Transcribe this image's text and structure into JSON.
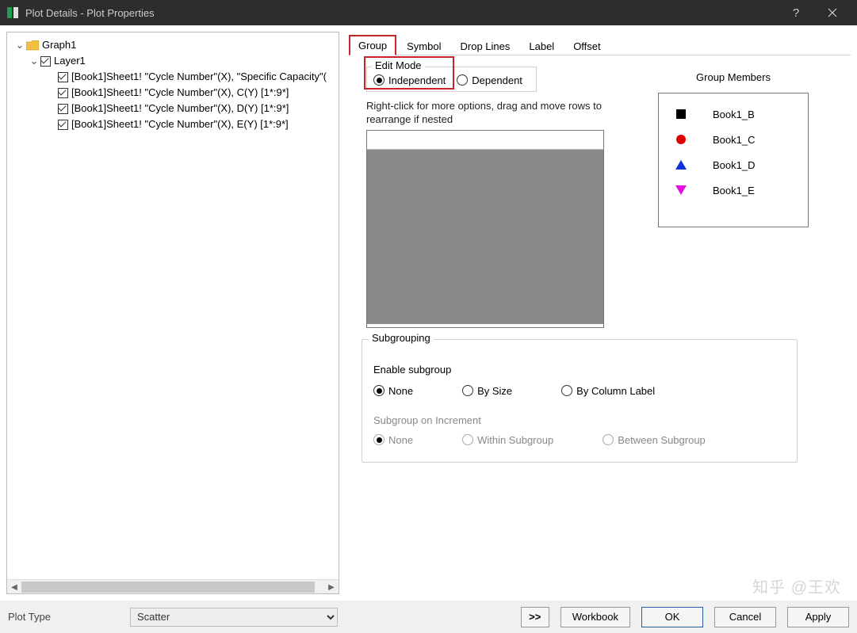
{
  "window": {
    "title": "Plot Details - Plot Properties"
  },
  "tree": {
    "root": "Graph1",
    "layer": "Layer1",
    "items": [
      "[Book1]Sheet1! \"Cycle Number\"(X), \"Specific Capacity\"(",
      "[Book1]Sheet1! \"Cycle Number\"(X), C(Y) [1*:9*]",
      "[Book1]Sheet1! \"Cycle Number\"(X), D(Y) [1*:9*]",
      "[Book1]Sheet1! \"Cycle Number\"(X), E(Y) [1*:9*]"
    ]
  },
  "tabs": [
    "Group",
    "Symbol",
    "Drop Lines",
    "Label",
    "Offset"
  ],
  "editmode": {
    "legend": "Edit Mode",
    "independent": "Independent",
    "dependent": "Dependent"
  },
  "hint": "Right-click for more options, drag and move rows to  rearrange if nested",
  "members": {
    "title": "Group Members",
    "items": [
      "Book1_B",
      "Book1_C",
      "Book1_D",
      "Book1_E"
    ]
  },
  "subgroup": {
    "legend": "Subgrouping",
    "enable_label": "Enable subgroup",
    "none": "None",
    "by_size": "By Size",
    "by_col": "By Column Label",
    "incr_label": "Subgroup on Increment",
    "none2": "None",
    "within": "Within Subgroup",
    "between": "Between Subgroup"
  },
  "footer": {
    "plot_type_label": "Plot Type",
    "plot_type_value": "Scatter",
    "toggle": ">>",
    "workbook": "Workbook",
    "ok": "OK",
    "cancel": "Cancel",
    "apply": "Apply"
  },
  "watermark": "知乎 @王欢"
}
